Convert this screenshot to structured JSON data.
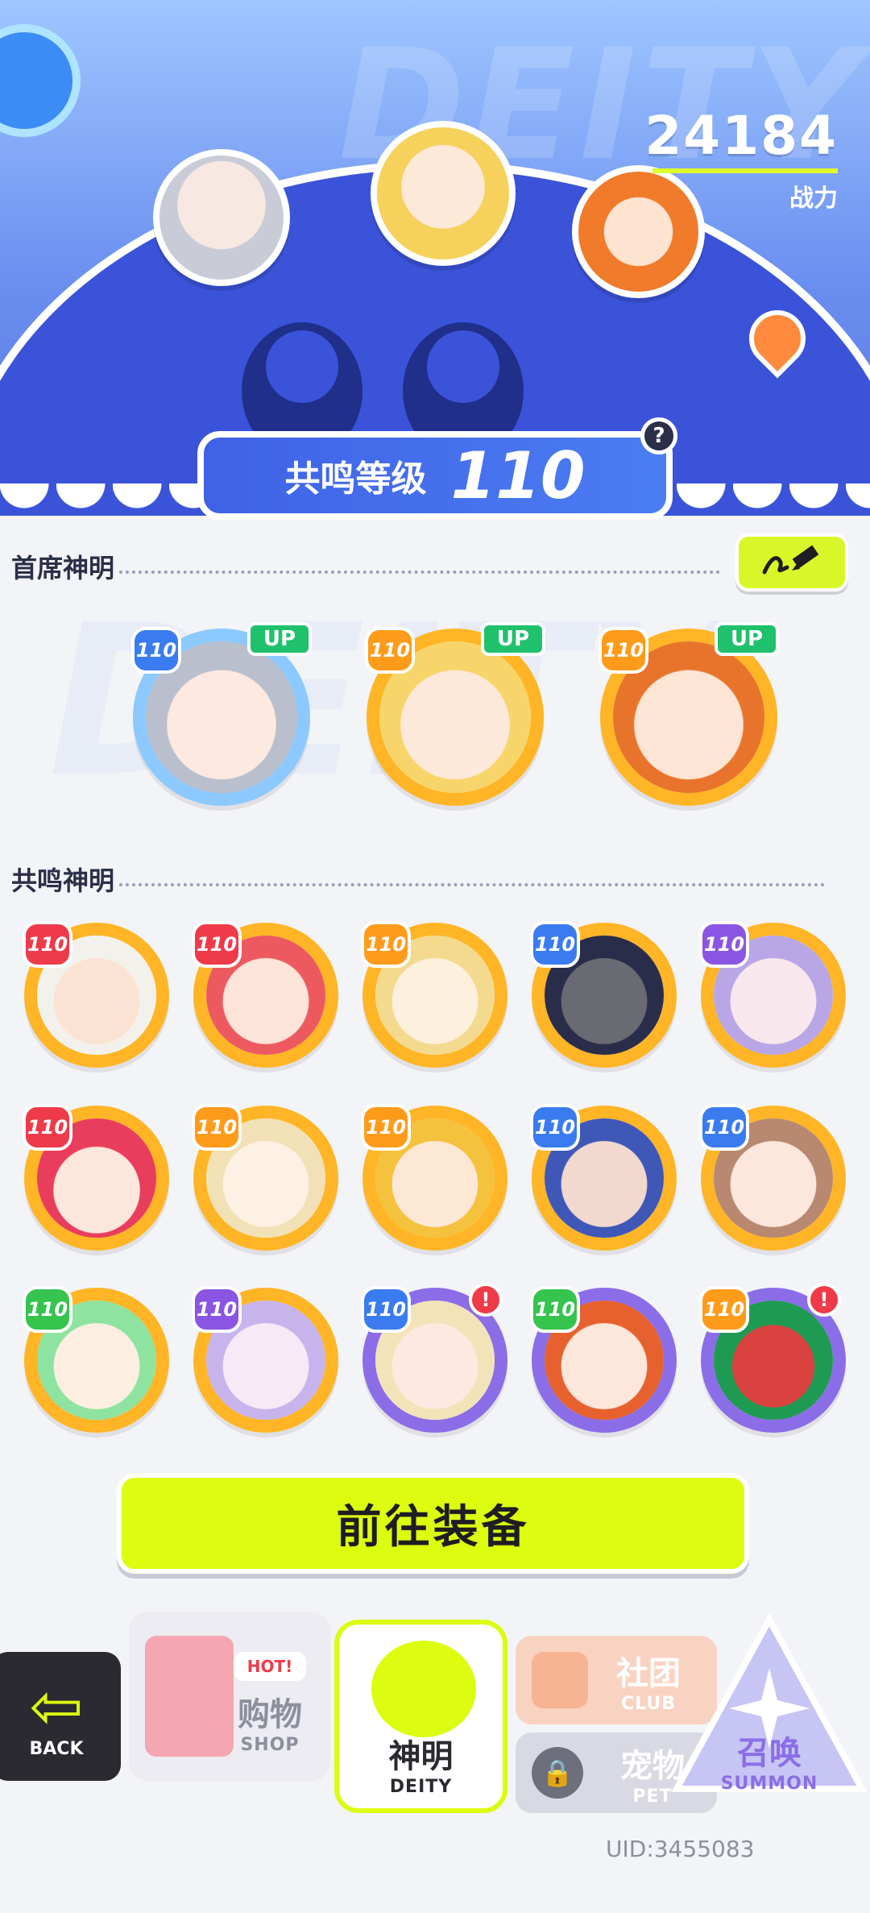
{
  "hero": {
    "power_value": "24184",
    "power_label": "战力",
    "resonance_label": "共鸣等级",
    "resonance_value": "110",
    "help_glyph": "?"
  },
  "sections": {
    "chief_title": "首席神明",
    "resonance_title": "共鸣神明"
  },
  "chief_deities": [
    {
      "level": "110",
      "badge": "UP"
    },
    {
      "level": "110",
      "badge": "UP"
    },
    {
      "level": "110",
      "badge": "UP"
    }
  ],
  "resonance_deities": [
    {
      "level": "110"
    },
    {
      "level": "110"
    },
    {
      "level": "110"
    },
    {
      "level": "110"
    },
    {
      "level": "110"
    },
    {
      "level": "110"
    },
    {
      "level": "110"
    },
    {
      "level": "110"
    },
    {
      "level": "110"
    },
    {
      "level": "110"
    },
    {
      "level": "110"
    },
    {
      "level": "110"
    },
    {
      "level": "110",
      "alert": "!"
    },
    {
      "level": "110"
    },
    {
      "level": "110",
      "alert": "!"
    }
  ],
  "equip_button_label": "前往装备",
  "nav": {
    "back": "BACK",
    "shop_cn": "购物",
    "shop_en": "SHOP",
    "shop_tag": "HOT!",
    "deity_cn": "神明",
    "deity_en": "DEITY",
    "club_cn": "社团",
    "club_en": "CLUB",
    "pet_cn": "宠物",
    "pet_en": "PET",
    "summon_cn": "召唤",
    "summon_en": "SUMMON"
  },
  "uid": "UID:3455083",
  "colors": {
    "accent_lime": "#dcfc10",
    "frame_gold": "#ffb526",
    "frame_purple": "#8b6de8",
    "hero_blue": "#3b53d8"
  }
}
